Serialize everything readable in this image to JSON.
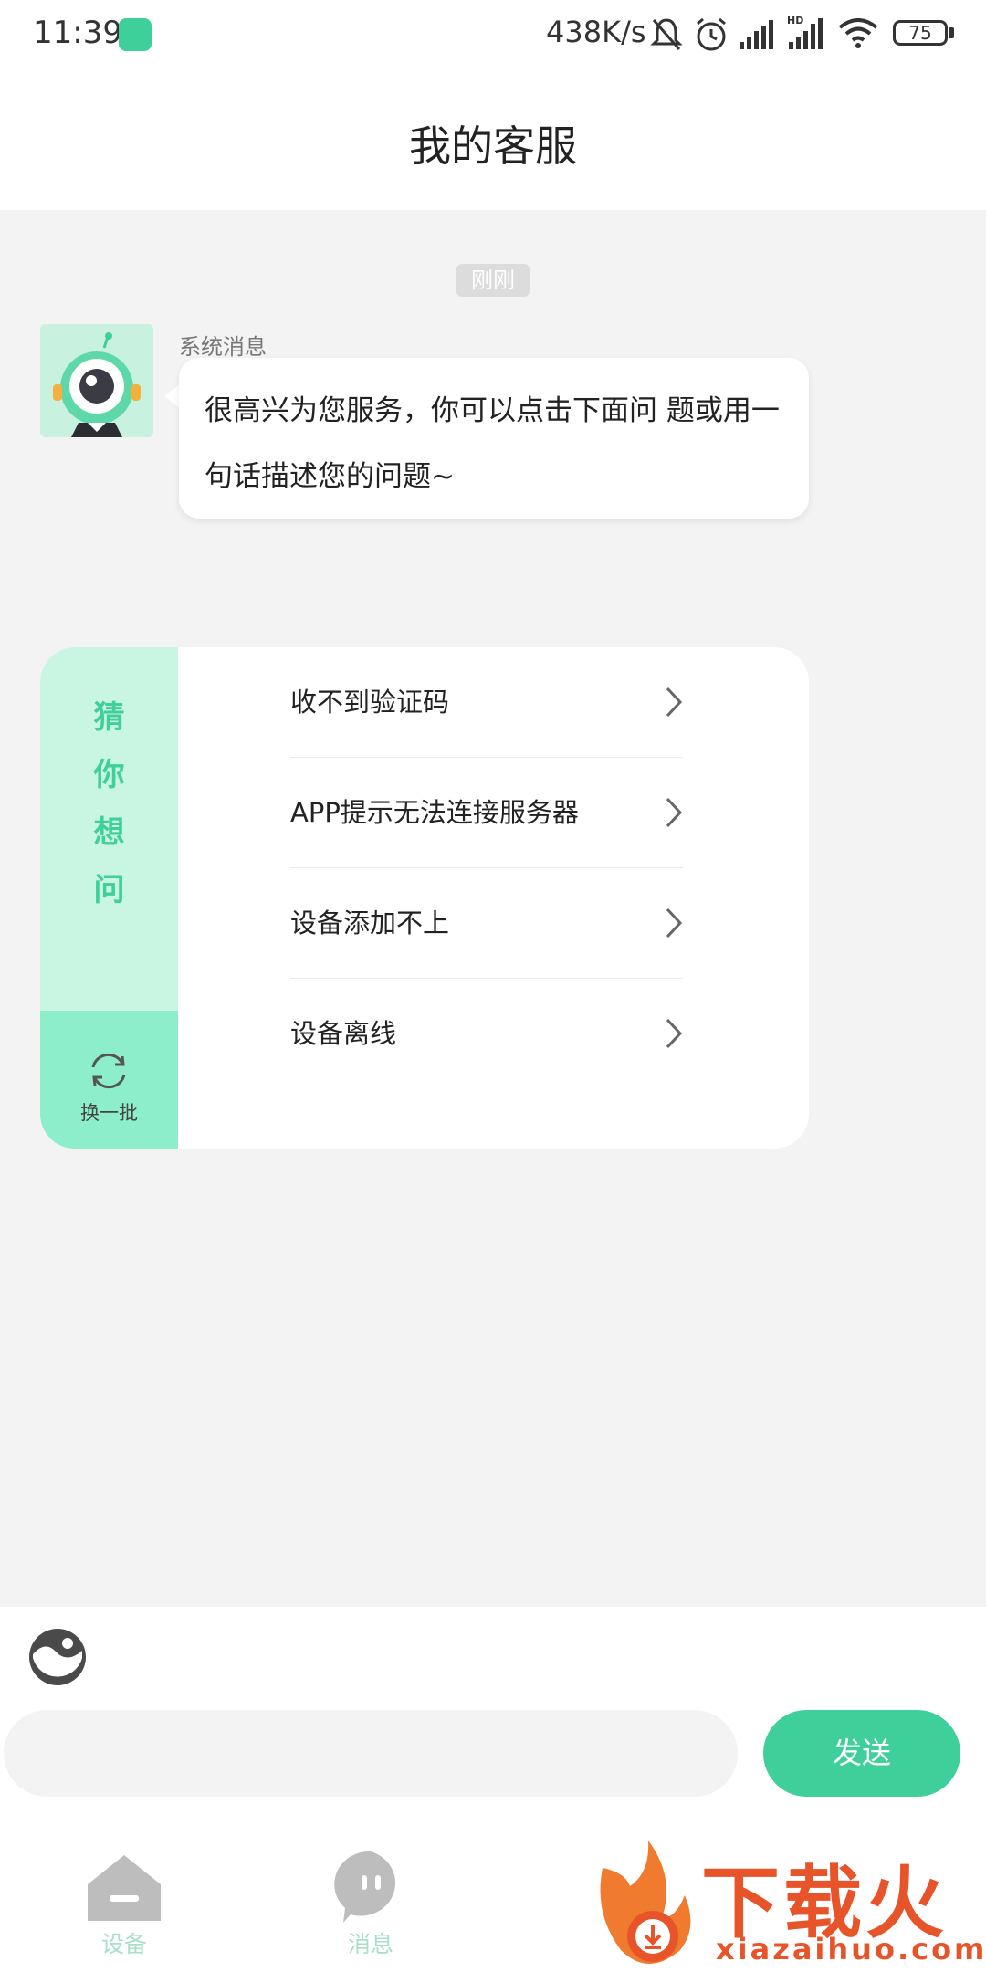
{
  "status_bar": {
    "time": "11:39",
    "network_speed": "438K/s",
    "battery": "75"
  },
  "header": {
    "title": "我的客服"
  },
  "chat": {
    "timestamp": "刚刚",
    "sender_name": "系统消息",
    "message": "很高兴为您服务，你可以点击下面问 题或用一句话描述您的问题~"
  },
  "guess": {
    "title": "猜你想问",
    "refresh_label": "换一批",
    "questions": [
      "收不到验证码",
      "APP提示无法连接服务器",
      "设备添加不上",
      "设备离线"
    ]
  },
  "input": {
    "placeholder": "",
    "send_label": "发送"
  },
  "bottom_nav": {
    "items": [
      {
        "label": "设备",
        "icon": "house-icon"
      },
      {
        "label": "消息",
        "icon": "chat-bubble-icon"
      }
    ]
  },
  "watermark": {
    "title": "下载火",
    "domain": "xiazaihuo.com"
  },
  "colors": {
    "accent": "#3ecf9b",
    "side_panel": "#c9f6e3",
    "refresh_panel": "#8deecb",
    "background": "#f3f3f3",
    "watermark": "#e8542a"
  }
}
